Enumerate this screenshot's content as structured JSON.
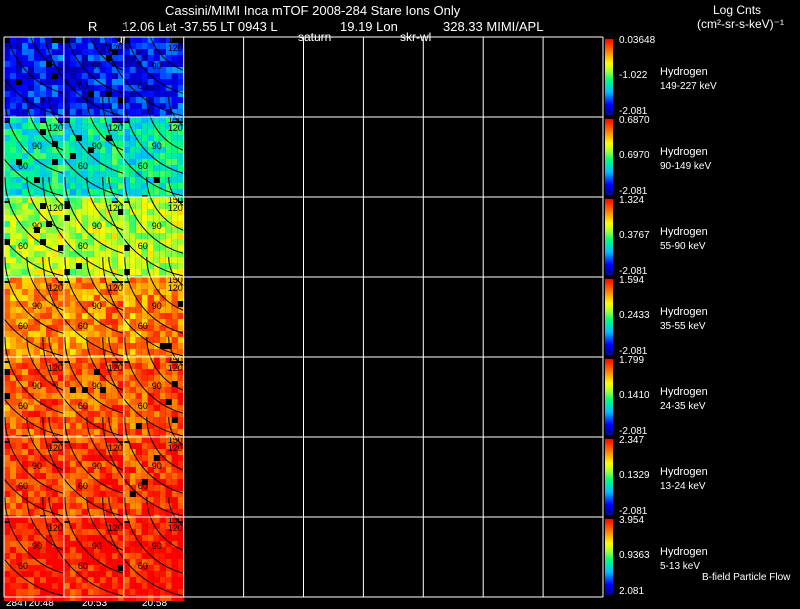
{
  "header": {
    "line1": "Cassini/MIMI Inca mTOF  2008-284   Stare   Ions Only",
    "r_label": "R",
    "lat_text": "12.06 Lat -37.55 LT 0943 L",
    "lon_text": "19.19 Lon",
    "mimi_text": "328.33  MIMI/APL",
    "units_line1": "Log Cnts",
    "units_line2": "(cm²-sr-s-keV)⁻¹",
    "satur_label": "satur",
    "saturn_label": "saturn",
    "skr_label": "skr-wl"
  },
  "footer": {
    "flow_label": "B-field Particle Flow",
    "time_labels": [
      "284T20:48",
      "20:53",
      "20:58"
    ]
  },
  "colors": {
    "background": "#000000",
    "grid": "#ffffff"
  },
  "chart_data": {
    "type": "heatmap",
    "title": "Cassini/MIMI Inca mTOF  2008-284   Stare   Ions Only",
    "grid_columns": 10,
    "filled_columns": 3,
    "contour_labels": [
      "60",
      "90",
      "120",
      "150"
    ],
    "species": "Hydrogen",
    "rows": [
      {
        "species": "Hydrogen",
        "band": "149-227 keV",
        "cb_max": "0.03648",
        "cb_mid": "-1.022",
        "cb_min": "-2.081",
        "level": 0.12
      },
      {
        "species": "Hydrogen",
        "band": "90-149 keV",
        "cb_max": "0.6870",
        "cb_mid": "0.6970",
        "cb_min": "-2.081",
        "level": 0.38
      },
      {
        "species": "Hydrogen",
        "band": "55-90 keV",
        "cb_max": "1.324",
        "cb_mid": "0.3767",
        "cb_min": "-2.081",
        "level": 0.58
      },
      {
        "species": "Hydrogen",
        "band": "35-55 keV",
        "cb_max": "1.594",
        "cb_mid": "0.2433",
        "cb_min": "-2.081",
        "level": 0.8
      },
      {
        "species": "Hydrogen",
        "band": "24-35 keV",
        "cb_max": "1.799",
        "cb_mid": "0.1410",
        "cb_min": "-2.081",
        "level": 0.86
      },
      {
        "species": "Hydrogen",
        "band": "13-24 keV",
        "cb_max": "2.347",
        "cb_mid": "0.1329",
        "cb_min": "-2.081",
        "level": 0.9
      },
      {
        "species": "Hydrogen",
        "band": "5-13 keV",
        "cb_max": "3.954",
        "cb_mid": "0.9363",
        "cb_min": "2.081",
        "level": 0.95
      }
    ]
  }
}
